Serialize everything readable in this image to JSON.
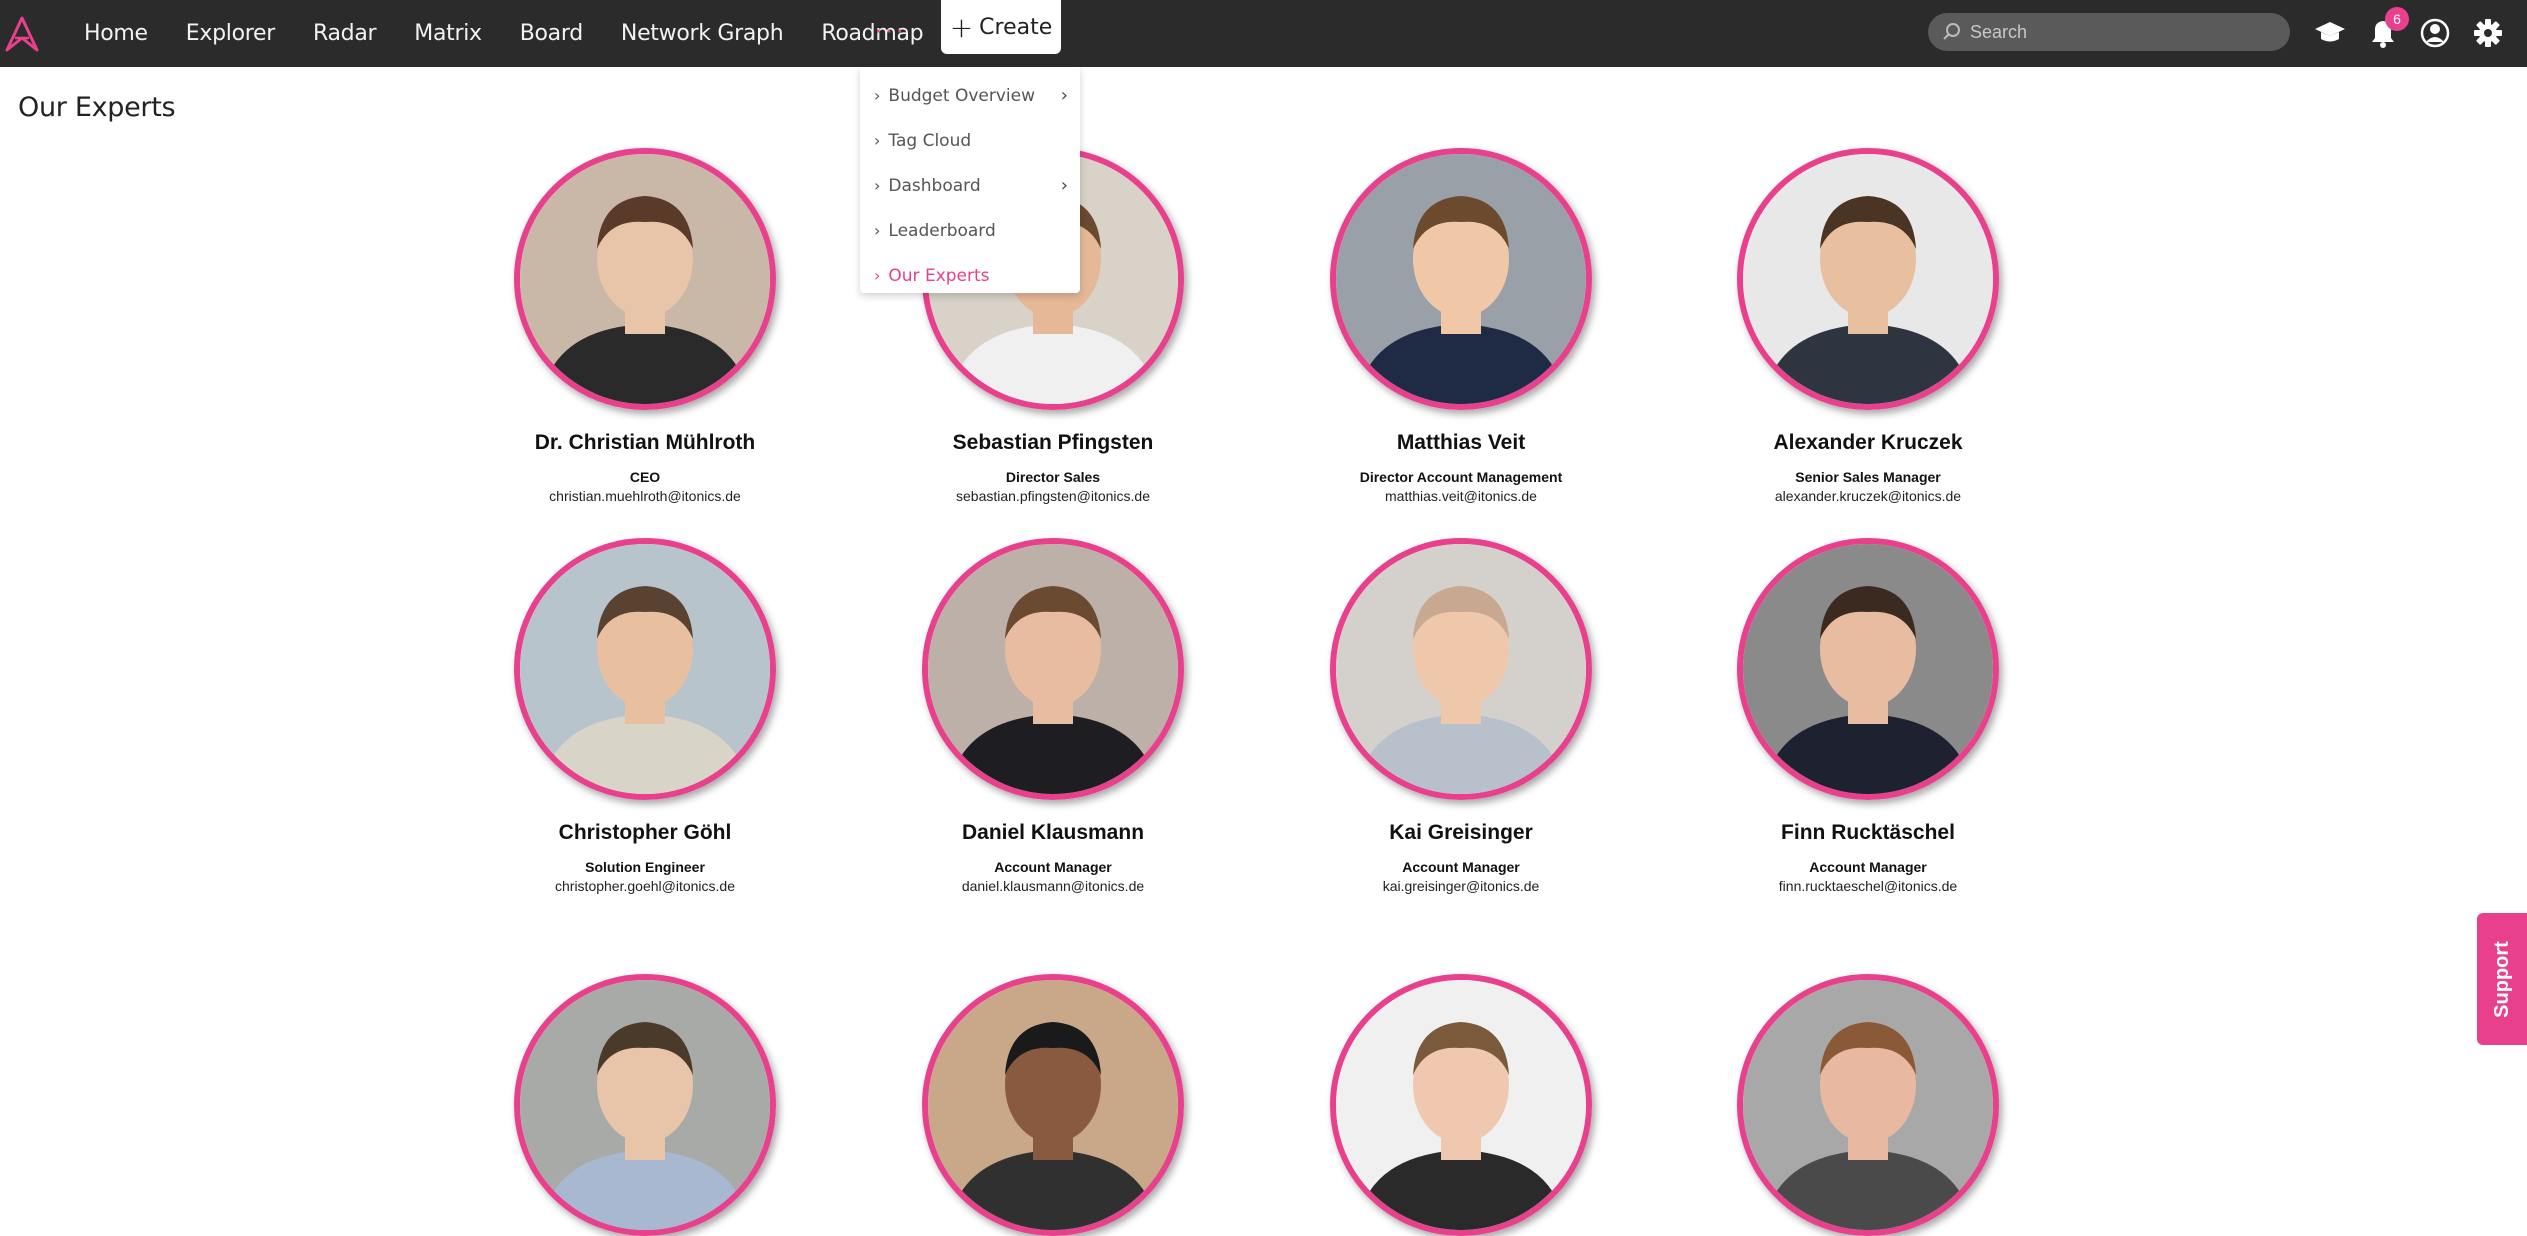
{
  "nav": {
    "items": [
      "Home",
      "Explorer",
      "Radar",
      "Matrix",
      "Board",
      "Network Graph",
      "Roadmap"
    ],
    "more_label": "···",
    "create_label": "Create"
  },
  "search": {
    "placeholder": "Search"
  },
  "notifications": {
    "count": "6"
  },
  "dropdown": {
    "items": [
      {
        "label": "Budget Overview",
        "has_submenu": true,
        "active": false
      },
      {
        "label": "Tag Cloud",
        "has_submenu": false,
        "active": false
      },
      {
        "label": "Dashboard",
        "has_submenu": true,
        "active": false
      },
      {
        "label": "Leaderboard",
        "has_submenu": false,
        "active": false
      },
      {
        "label": "Our Experts",
        "has_submenu": false,
        "active": true
      }
    ]
  },
  "page": {
    "title": "Our Experts"
  },
  "experts": [
    {
      "name": "Dr. Christian Mühlroth",
      "role": "CEO",
      "email": "christian.muehlroth@itonics.de"
    },
    {
      "name": "Sebastian Pfingsten",
      "role": "Director Sales",
      "email": "sebastian.pfingsten@itonics.de"
    },
    {
      "name": "Matthias Veit",
      "role": "Director Account Management",
      "email": "matthias.veit@itonics.de"
    },
    {
      "name": "Alexander Kruczek",
      "role": "Senior Sales Manager",
      "email": "alexander.kruczek@itonics.de"
    },
    {
      "name": "Christopher Göhl",
      "role": "Solution Engineer",
      "email": "christopher.goehl@itonics.de"
    },
    {
      "name": "Daniel Klausmann",
      "role": "Account Manager",
      "email": "daniel.klausmann@itonics.de"
    },
    {
      "name": "Kai Greisinger",
      "role": "Account Manager",
      "email": "kai.greisinger@itonics.de"
    },
    {
      "name": "Finn Rucktäschel",
      "role": "Account Manager",
      "email": "finn.rucktaeschel@itonics.de"
    },
    {
      "name": "",
      "role": "",
      "email": ""
    },
    {
      "name": "",
      "role": "",
      "email": ""
    },
    {
      "name": "",
      "role": "",
      "email": ""
    },
    {
      "name": "",
      "role": "",
      "email": ""
    }
  ],
  "support": {
    "label": "Support"
  },
  "colors": {
    "accent": "#e8408c",
    "topbar": "#2b2b2b"
  }
}
